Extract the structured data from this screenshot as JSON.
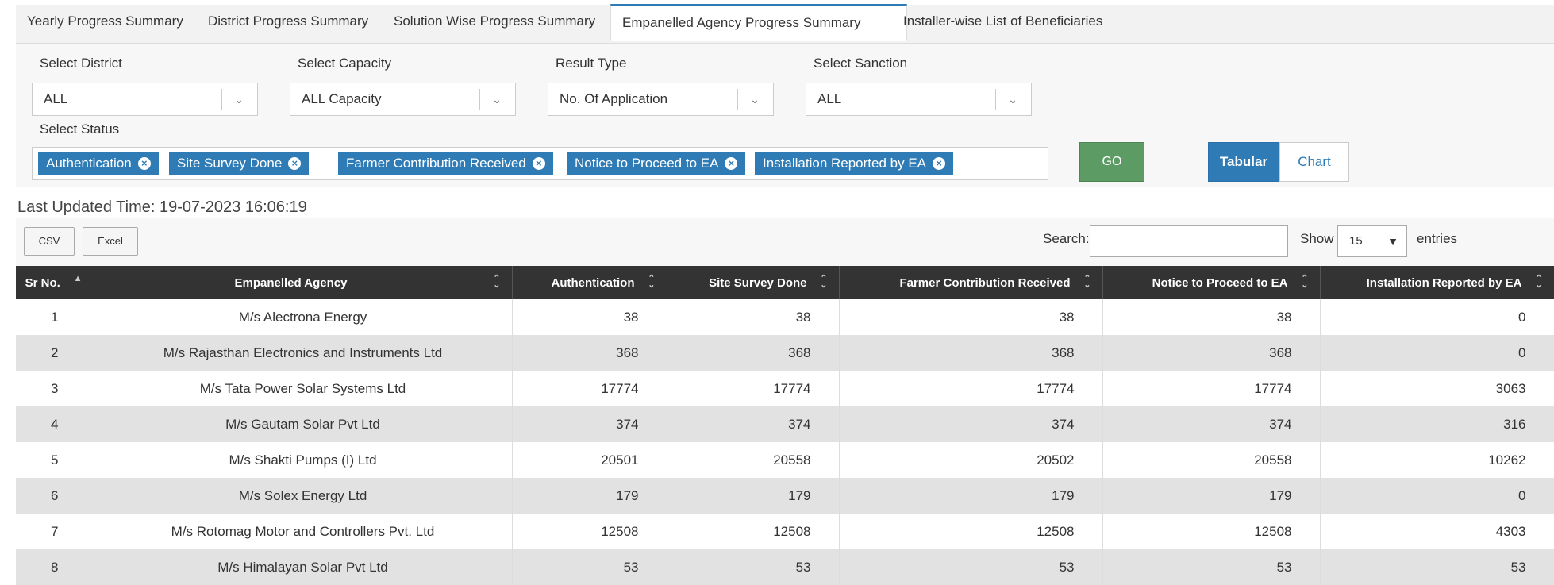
{
  "tabs": [
    {
      "label": "Yearly Progress Summary"
    },
    {
      "label": "District Progress Summary"
    },
    {
      "label": "Solution Wise Progress Summary"
    },
    {
      "label": "Empanelled Agency Progress Summary"
    },
    {
      "label": "Installer-wise List of Beneficiaries"
    }
  ],
  "filters": {
    "district": {
      "label": "Select District",
      "value": "ALL"
    },
    "capacity": {
      "label": "Select Capacity",
      "value": "ALL Capacity"
    },
    "result_type": {
      "label": "Result Type",
      "value": "No. Of Application"
    },
    "sanction": {
      "label": "Select Sanction",
      "value": "ALL"
    },
    "status": {
      "label": "Select Status",
      "tags": [
        "Authentication",
        "Site Survey Done",
        "Farmer Contribution Received",
        "Notice to Proceed to EA",
        "Installation Reported by EA"
      ]
    },
    "go_label": "GO",
    "view": {
      "tabular_label": "Tabular",
      "chart_label": "Chart",
      "active": "Tabular"
    }
  },
  "last_updated": "Last Updated Time: 19-07-2023 16:06:19",
  "toolbar": {
    "csv_label": "CSV",
    "excel_label": "Excel",
    "search_label": "Search:",
    "search_value": "",
    "show_label": "Show",
    "page_length": "15",
    "entries_label": "entries"
  },
  "table": {
    "columns": [
      "Sr No.",
      "Empanelled Agency",
      "Authentication",
      "Site Survey Done",
      "Farmer Contribution Received",
      "Notice to Proceed to EA",
      "Installation Reported by EA"
    ],
    "rows": [
      [
        "1",
        "M/s Alectrona Energy",
        "38",
        "38",
        "38",
        "38",
        "0"
      ],
      [
        "2",
        "M/s Rajasthan Electronics and Instruments Ltd",
        "368",
        "368",
        "368",
        "368",
        "0"
      ],
      [
        "3",
        "M/s Tata Power Solar Systems Ltd",
        "17774",
        "17774",
        "17774",
        "17774",
        "3063"
      ],
      [
        "4",
        "M/s Gautam Solar Pvt Ltd",
        "374",
        "374",
        "374",
        "374",
        "316"
      ],
      [
        "5",
        "M/s Shakti Pumps (I) Ltd",
        "20501",
        "20558",
        "20502",
        "20558",
        "10262"
      ],
      [
        "6",
        "M/s Solex Energy Ltd",
        "179",
        "179",
        "179",
        "179",
        "0"
      ],
      [
        "7",
        "M/s Rotomag Motor and Controllers Pvt. Ltd",
        "12508",
        "12508",
        "12508",
        "12508",
        "4303"
      ],
      [
        "8",
        "M/s Himalayan Solar Pvt Ltd",
        "53",
        "53",
        "53",
        "53",
        "53"
      ]
    ]
  }
}
